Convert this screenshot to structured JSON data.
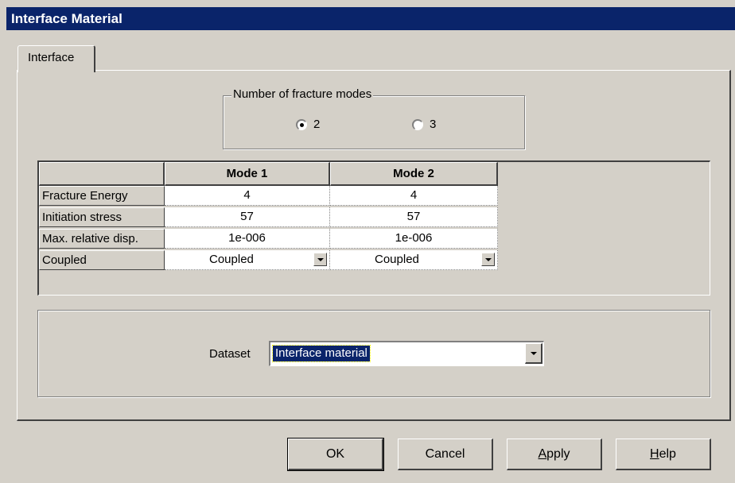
{
  "window": {
    "title": "Interface Material"
  },
  "tabs": [
    {
      "label": "Interface"
    }
  ],
  "fracture_modes": {
    "group_label": "Number of fracture modes",
    "options": [
      {
        "label": "2",
        "selected": true
      },
      {
        "label": "3",
        "selected": false
      }
    ]
  },
  "table": {
    "columns": [
      "Mode 1",
      "Mode 2"
    ],
    "rows": [
      {
        "label": "Fracture Energy",
        "values": [
          "4",
          "4"
        ]
      },
      {
        "label": "Initiation stress",
        "values": [
          "57",
          "57"
        ]
      },
      {
        "label": "Max. relative disp.",
        "values": [
          "1e-006",
          "1e-006"
        ]
      },
      {
        "label": "Coupled",
        "values": [
          "Coupled",
          "Coupled"
        ]
      }
    ]
  },
  "dataset": {
    "label": "Dataset",
    "value": "Interface material"
  },
  "buttons": {
    "ok": "OK",
    "cancel": "Cancel",
    "apply": "Apply",
    "help": "Help"
  },
  "colors": {
    "titlebar": "#0a246a",
    "face": "#d4d0c8",
    "selection": "#0a246a"
  }
}
